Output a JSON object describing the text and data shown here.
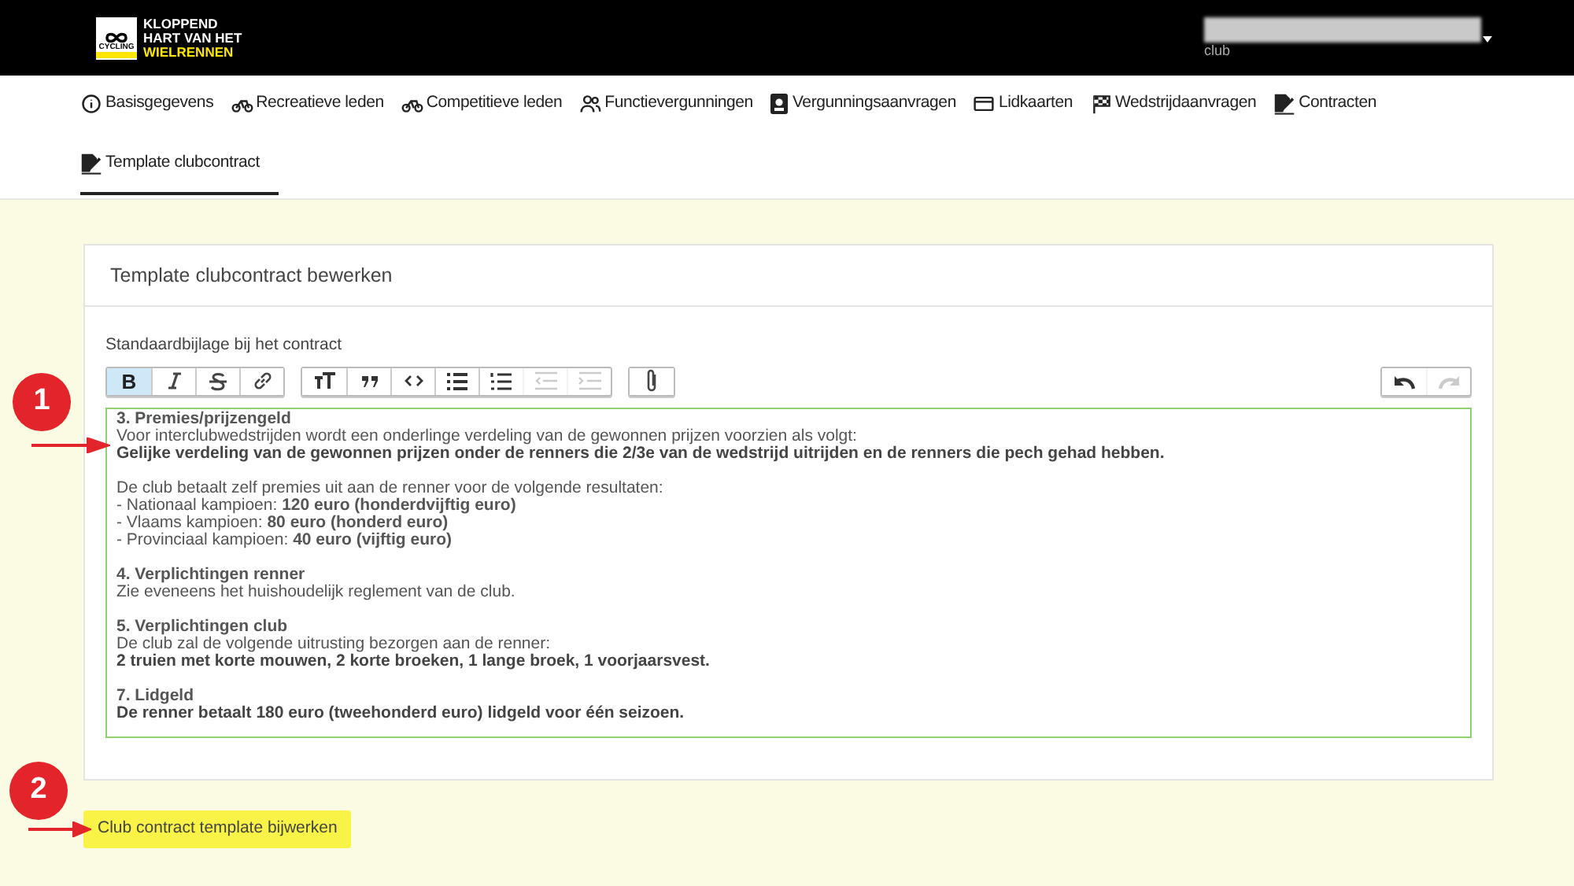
{
  "header": {
    "logo": {
      "lines": [
        "KLOPPEND",
        "HART VAN HET",
        "WIELRENNEN"
      ],
      "badge": "CYCLING"
    },
    "user": {
      "role": "club"
    }
  },
  "nav": {
    "tabs": [
      {
        "label": "Basisgegevens",
        "kind": "info",
        "selected": false
      },
      {
        "label": "Recreatieve leden",
        "kind": "bike",
        "selected": false
      },
      {
        "label": "Competitieve leden",
        "kind": "bike",
        "selected": false
      },
      {
        "label": "Functievergunningen",
        "kind": "users",
        "selected": false
      },
      {
        "label": "Vergunningsaanvragen",
        "kind": "badge",
        "selected": false
      },
      {
        "label": "Lidkaarten",
        "kind": "card",
        "selected": false
      },
      {
        "label": "Wedstrijdaanvragen",
        "kind": "flag",
        "selected": false
      },
      {
        "label": "Contracten",
        "kind": "sign",
        "selected": false
      },
      {
        "label": "Template clubcontract",
        "kind": "sign",
        "selected": true
      }
    ]
  },
  "card": {
    "title": "Template clubcontract bewerken",
    "field_label": "Standaardbijlage bij het contract",
    "toolbar": [
      [
        {
          "kind": "bold",
          "label": "B",
          "selected": true,
          "disabled": false
        },
        {
          "kind": "italic",
          "selected": false,
          "disabled": false
        },
        {
          "kind": "strike",
          "selected": false,
          "disabled": false
        },
        {
          "kind": "link",
          "selected": false,
          "disabled": false
        }
      ],
      [
        {
          "kind": "heading",
          "selected": false,
          "disabled": false
        },
        {
          "kind": "quote",
          "selected": false,
          "disabled": false
        },
        {
          "kind": "code",
          "selected": false,
          "disabled": false
        },
        {
          "kind": "bullets",
          "selected": false,
          "disabled": false
        },
        {
          "kind": "numbers",
          "selected": false,
          "disabled": false
        },
        {
          "kind": "outdent",
          "selected": false,
          "disabled": true
        },
        {
          "kind": "indent",
          "selected": false,
          "disabled": true
        }
      ],
      [
        {
          "kind": "attach",
          "selected": false,
          "disabled": false
        }
      ]
    ],
    "history": [
      {
        "kind": "undo",
        "disabled": false
      },
      {
        "kind": "redo",
        "disabled": true
      }
    ],
    "lines": [
      {
        "kind": "heading",
        "text": "3. Premies/prijzengeld"
      },
      {
        "kind": "text",
        "text": "Voor interclubwedstrijden wordt een onderlinge verdeling van de gewonnen prijzen voorzien als volgt:"
      },
      {
        "kind": "bold",
        "text": "Gelijke verdeling van de gewonnen prijzen onder de renners die 2/3e van de wedstrijd uitrijden en de renners die pech gehad hebben."
      },
      {
        "kind": "blank"
      },
      {
        "kind": "text",
        "text": "De club betaalt zelf premies uit aan de renner voor de volgende resultaten:"
      },
      {
        "kind": "text",
        "text": "- Nationaal kampioen: **120 euro (honderdvijftig euro)**"
      },
      {
        "kind": "text",
        "text": "- Vlaams kampioen: **80 euro (honderd euro)**"
      },
      {
        "kind": "text",
        "text": "- Provinciaal kampioen: **40 euro (vijftig euro)**"
      },
      {
        "kind": "blank"
      },
      {
        "kind": "heading",
        "text": "4. Verplichtingen renner"
      },
      {
        "kind": "text",
        "text": "Zie eveneens het huishoudelijk reglement van de club."
      },
      {
        "kind": "blank"
      },
      {
        "kind": "heading",
        "text": "5. Verplichtingen club"
      },
      {
        "kind": "text",
        "text": "De club zal de volgende uitrusting bezorgen aan de renner:"
      },
      {
        "kind": "bold",
        "text": "2 truien met korte mouwen, 2 korte broeken, 1 lange broek, 1 voorjaarsvest."
      },
      {
        "kind": "blank"
      },
      {
        "kind": "heading",
        "text": "7. Lidgeld"
      },
      {
        "kind": "bold",
        "text": "De renner betaalt 180 euro (tweehonderd euro) lidgeld voor één seizoen."
      }
    ]
  },
  "submit_button": "Club contract template bijwerken",
  "annotations": [
    {
      "number": "1"
    },
    {
      "number": "2"
    }
  ]
}
